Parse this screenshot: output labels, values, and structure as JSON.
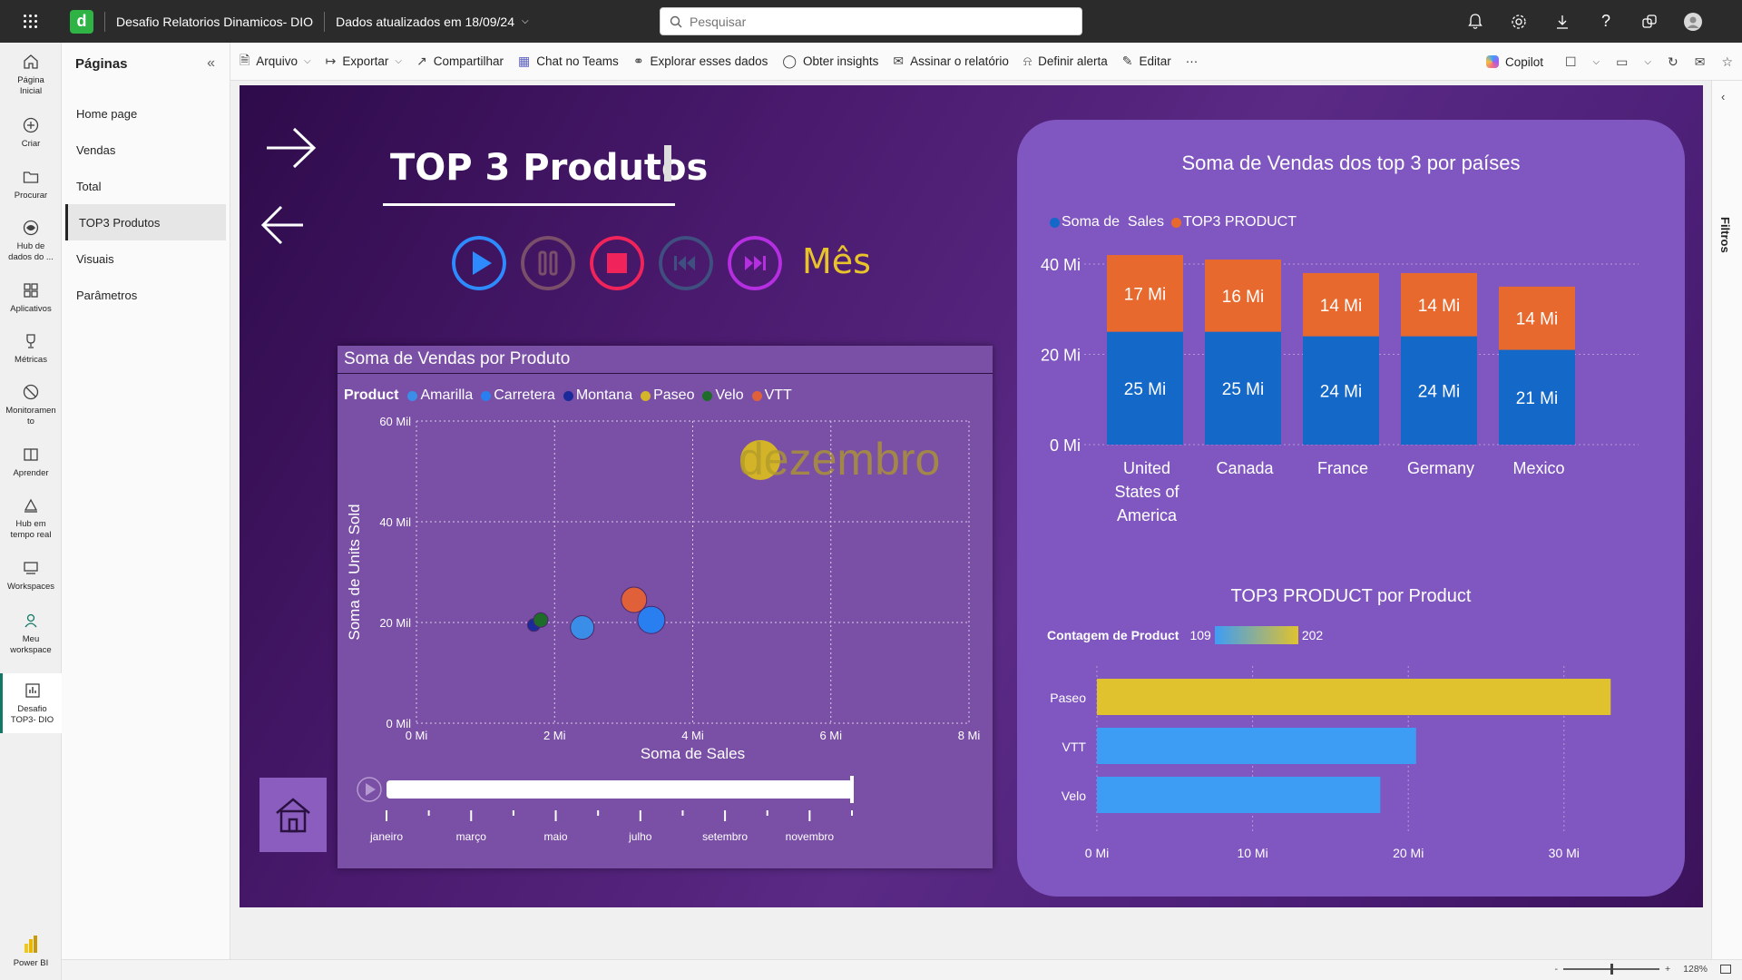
{
  "topbar": {
    "workspace": "Desafio Relatorios Dinamicos- DIO",
    "updated": "Dados atualizados em 18/09/24",
    "search_placeholder": "Pesquisar"
  },
  "rail": [
    {
      "label": "Página Inicial",
      "icon": "home-icon"
    },
    {
      "label": "Criar",
      "icon": "plus-circle-icon"
    },
    {
      "label": "Procurar",
      "icon": "folder-icon"
    },
    {
      "label": "Hub de dados do ...",
      "icon": "data-hub-icon"
    },
    {
      "label": "Aplicativos",
      "icon": "apps-icon"
    },
    {
      "label": "Métricas",
      "icon": "trophy-icon"
    },
    {
      "label": "Monitoramento",
      "icon": "monitor-icon"
    },
    {
      "label": "Aprender",
      "icon": "book-icon"
    },
    {
      "label": "Hub em tempo real",
      "icon": "realtime-icon"
    },
    {
      "label": "Workspaces",
      "icon": "workspaces-icon"
    },
    {
      "label": "Meu workspace",
      "icon": "person-icon"
    },
    {
      "label": "Desafio TOP3- DIO",
      "icon": "report-icon"
    },
    {
      "label": "Power BI",
      "icon": "powerbi-logo"
    }
  ],
  "pages": {
    "heading": "Páginas",
    "items": [
      "Home page",
      "Vendas",
      "Total",
      "TOP3 Produtos",
      "Visuais",
      "Parâmetros"
    ],
    "active": "TOP3 Produtos"
  },
  "toolbar": {
    "file": "Arquivo",
    "export": "Exportar",
    "share": "Compartilhar",
    "teams": "Chat no Teams",
    "explore": "Explorar esses dados",
    "insights": "Obter insights",
    "subscribe": "Assinar o relatório",
    "alert": "Definir alerta",
    "edit": "Editar",
    "more": "···",
    "copilot": "Copilot"
  },
  "filters_label": "Filtros",
  "report": {
    "title": "TOP 3 Produtos",
    "play_axis_label": "Mês",
    "scatter": {
      "title": "Soma de Vendas por Produto",
      "legend_title": "Product",
      "watermark": "dezembro",
      "xlabel": "Soma de Sales",
      "ylabel": "Soma de Units Sold",
      "xticks": [
        "0 Mi",
        "2 Mi",
        "4 Mi",
        "6 Mi",
        "8 Mi"
      ],
      "yticks": [
        "0 Mil",
        "20 Mil",
        "40 Mil",
        "60 Mil"
      ],
      "months": [
        "janeiro",
        "março",
        "maio",
        "julho",
        "setembro",
        "novembro"
      ]
    },
    "stacked": {
      "title": "Soma de Vendas dos top 3 por países",
      "legend": [
        "Soma de  Sales",
        "TOP3 PRODUCT"
      ],
      "yticks": [
        "40 Mi",
        "20 Mi",
        "0 Mi"
      ],
      "category_lines": [
        [
          "United",
          "States of",
          "America"
        ],
        [
          "Canada"
        ],
        [
          "France"
        ],
        [
          "Germany"
        ],
        [
          "Mexico"
        ]
      ]
    },
    "bars": {
      "title": "TOP3 PRODUCT por Product",
      "gradient_label": "Contagem de Product",
      "gradient_min": "109",
      "gradient_max": "202",
      "xticks": [
        "0 Mi",
        "10 Mi",
        "20 Mi",
        "30 Mi"
      ]
    }
  },
  "status": {
    "zoom": "128%"
  },
  "chart_data": [
    {
      "type": "scatter",
      "title": "Soma de Vendas por Produto",
      "xlabel": "Soma de Sales",
      "ylabel": "Soma de Units Sold",
      "xlim": [
        0,
        8000000
      ],
      "ylim": [
        0,
        60000
      ],
      "grid": true,
      "legend_position": "top-left",
      "series": [
        {
          "name": "Amarilla",
          "color": "#3b8ee8",
          "points": [
            {
              "x": 2400000,
              "y": 19000,
              "size": 13
            }
          ]
        },
        {
          "name": "Carretera",
          "color": "#2a7ff0",
          "points": [
            {
              "x": 3400000,
              "y": 20500,
              "size": 15
            }
          ]
        },
        {
          "name": "Montana",
          "color": "#1a2a9a",
          "points": [
            {
              "x": 1700000,
              "y": 19500,
              "size": 7
            }
          ]
        },
        {
          "name": "Paseo",
          "color": "#d4b52a",
          "points": []
        },
        {
          "name": "Velo",
          "color": "#1f6b2a",
          "points": [
            {
              "x": 1800000,
              "y": 20500,
              "size": 8
            }
          ]
        },
        {
          "name": "VTT",
          "color": "#e0603a",
          "points": [
            {
              "x": 3150000,
              "y": 24500,
              "size": 14
            }
          ]
        }
      ]
    },
    {
      "type": "bar",
      "stacked": true,
      "title": "Soma de Vendas dos top 3 por países",
      "categories": [
        "United States of America",
        "Canada",
        "France",
        "Germany",
        "Mexico"
      ],
      "ylim": [
        0,
        42000000
      ],
      "grid": true,
      "legend_position": "top-left",
      "series": [
        {
          "name": "Soma de  Sales",
          "color": "#1468c8",
          "values": [
            25000000,
            25000000,
            24000000,
            24000000,
            21000000
          ],
          "labels": [
            "25 Mi",
            "25 Mi",
            "24 Mi",
            "24 Mi",
            "21 Mi"
          ]
        },
        {
          "name": "TOP3 PRODUCT",
          "color": "#e8692e",
          "values": [
            17000000,
            16000000,
            14000000,
            14000000,
            14000000
          ],
          "labels": [
            "17 Mi",
            "16 Mi",
            "14 Mi",
            "14 Mi",
            "14 Mi"
          ]
        }
      ]
    },
    {
      "type": "bar",
      "orientation": "horizontal",
      "title": "TOP3 PRODUCT por Product",
      "categories": [
        "Paseo",
        "VTT",
        "Velo"
      ],
      "values": [
        33000000,
        20500000,
        18200000
      ],
      "colors": [
        "#e0c22e",
        "#3d9df5",
        "#3d9df5"
      ],
      "xlim": [
        0,
        34000000
      ],
      "grid": true
    }
  ]
}
